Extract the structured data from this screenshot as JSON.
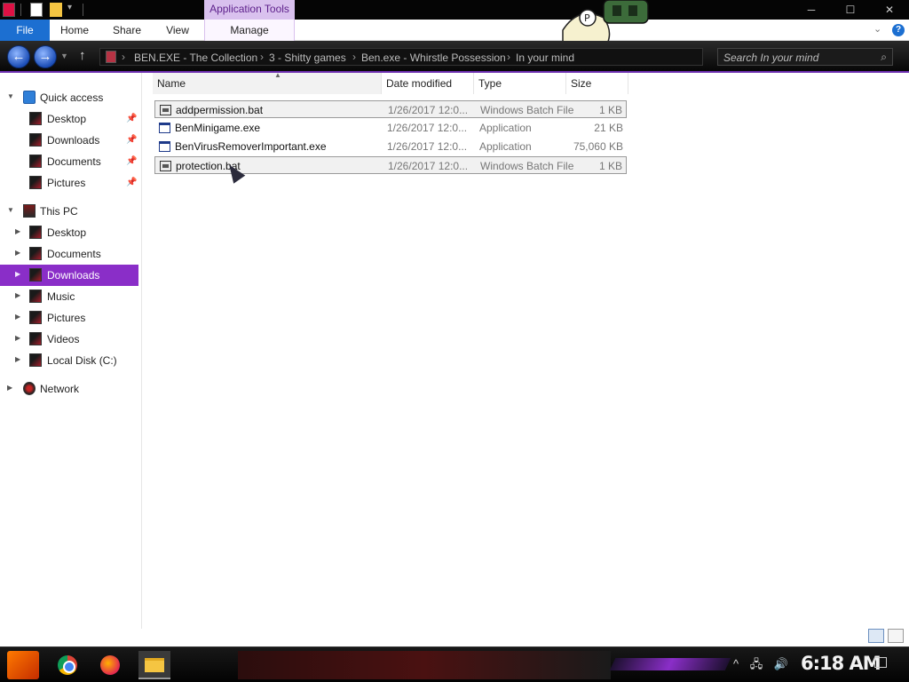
{
  "titlebar": {
    "context_tab": "Application Tools",
    "controls": [
      "─",
      "☐",
      "✕"
    ]
  },
  "ribbon": {
    "tabs": [
      "File",
      "Home",
      "Share",
      "View",
      "Manage"
    ]
  },
  "address": {
    "breadcrumbs": [
      "BEN.EXE - The Collection",
      "3 - Shitty games",
      "Ben.exe - Whirstle Possession",
      "In your mind"
    ],
    "search_placeholder": "Search In your mind"
  },
  "nav": {
    "items": [
      {
        "label": "Quick access",
        "level": 0,
        "arrow": "▼",
        "icon": "star-icon"
      },
      {
        "label": "Desktop",
        "level": 1,
        "pinned": true,
        "icon": "desktop-icon"
      },
      {
        "label": "Downloads",
        "level": 1,
        "pinned": true,
        "icon": "downloads-icon"
      },
      {
        "label": "Documents",
        "level": 1,
        "pinned": true,
        "icon": "documents-icon"
      },
      {
        "label": "Pictures",
        "level": 1,
        "pinned": true,
        "icon": "pictures-icon"
      },
      {
        "label": "This PC",
        "level": 0,
        "arrow": "▼",
        "icon": "pc-icon"
      },
      {
        "label": "Desktop",
        "level": 1,
        "arrow": "▶",
        "icon": "desktop-icon"
      },
      {
        "label": "Documents",
        "level": 1,
        "arrow": "▶",
        "icon": "documents-icon"
      },
      {
        "label": "Downloads",
        "level": 1,
        "arrow": "▶",
        "icon": "downloads-icon",
        "selected": true
      },
      {
        "label": "Music",
        "level": 1,
        "arrow": "▶",
        "icon": "music-icon"
      },
      {
        "label": "Pictures",
        "level": 1,
        "arrow": "▶",
        "icon": "pictures-icon"
      },
      {
        "label": "Videos",
        "level": 1,
        "arrow": "▶",
        "icon": "videos-icon"
      },
      {
        "label": "Local Disk (C:)",
        "level": 1,
        "arrow": "▶",
        "icon": "disk-icon"
      },
      {
        "label": "Network",
        "level": 0,
        "arrow": "▶",
        "icon": "network-icon"
      }
    ]
  },
  "files": {
    "columns": [
      "Name",
      "Date modified",
      "Type",
      "Size"
    ],
    "rows": [
      {
        "name": "addpermission.bat",
        "date": "1/26/2017 12:0...",
        "type": "Windows Batch File",
        "size": "1 KB",
        "kind": "bat",
        "selected": true
      },
      {
        "name": "BenMinigame.exe",
        "date": "1/26/2017 12:0...",
        "type": "Application",
        "size": "21 KB",
        "kind": "exe"
      },
      {
        "name": "BenVirusRemoverImportant.exe",
        "date": "1/26/2017 12:0...",
        "type": "Application",
        "size": "75,060 KB",
        "kind": "exe"
      },
      {
        "name": "protection.bat",
        "date": "1/26/2017 12:0...",
        "type": "Windows Batch File",
        "size": "1 KB",
        "kind": "bat",
        "selected": true
      }
    ]
  },
  "taskbar": {
    "clock": "6:18 AM",
    "apps": [
      "start-icon",
      "chrome-icon",
      "firefox-icon",
      "file-explorer-icon"
    ]
  },
  "colors": {
    "accent_purple": "#8a2ec8",
    "file_tab_blue": "#1c6fd1",
    "app_tools_bg": "#d9c1ee"
  }
}
